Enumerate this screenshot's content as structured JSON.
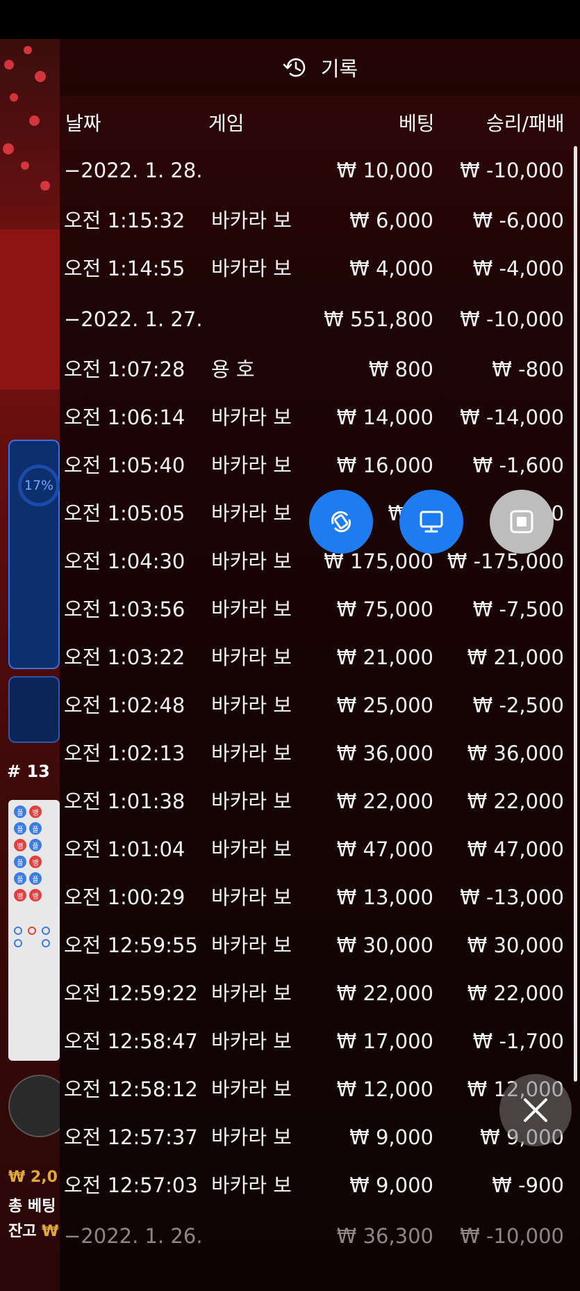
{
  "panel": {
    "title": "기록",
    "icon": "history-icon"
  },
  "columns": {
    "date": "날짜",
    "game": "게임",
    "bet": "베팅",
    "winloss": "승리/패배"
  },
  "rows": [
    {
      "type": "group",
      "date": "−2022. 1. 28.",
      "game": "",
      "bet": "₩ 10,000",
      "win": "₩ -10,000"
    },
    {
      "type": "item",
      "date": "오전 1:15:32",
      "game": "바카라 보",
      "bet": "₩ 6,000",
      "win": "₩ -6,000"
    },
    {
      "type": "item",
      "date": "오전 1:14:55",
      "game": "바카라 보",
      "bet": "₩ 4,000",
      "win": "₩ -4,000"
    },
    {
      "type": "group",
      "date": "−2022. 1. 27.",
      "game": "",
      "bet": "₩ 551,800",
      "win": "₩ -10,000"
    },
    {
      "type": "item",
      "date": "오전 1:07:28",
      "game": "용 호",
      "bet": "₩ 800",
      "win": "₩ -800"
    },
    {
      "type": "item",
      "date": "오전 1:06:14",
      "game": "바카라 보",
      "bet": "₩ 14,000",
      "win": "₩ -14,000"
    },
    {
      "type": "item",
      "date": "오전 1:05:40",
      "game": "바카라 보",
      "bet": "₩ 16,000",
      "win": "₩ -1,600"
    },
    {
      "type": "item",
      "date": "오전 1:05:05",
      "game": "바카라 보",
      "bet": "₩ 8,",
      "win": "00"
    },
    {
      "type": "item",
      "date": "오전 1:04:30",
      "game": "바카라 보",
      "bet": "₩ 175,000",
      "win": "₩ -175,000"
    },
    {
      "type": "item",
      "date": "오전 1:03:56",
      "game": "바카라 보",
      "bet": "₩ 75,000",
      "win": "₩ -7,500"
    },
    {
      "type": "item",
      "date": "오전 1:03:22",
      "game": "바카라 보",
      "bet": "₩ 21,000",
      "win": "₩ 21,000"
    },
    {
      "type": "item",
      "date": "오전 1:02:48",
      "game": "바카라 보",
      "bet": "₩ 25,000",
      "win": "₩ -2,500"
    },
    {
      "type": "item",
      "date": "오전 1:02:13",
      "game": "바카라 보",
      "bet": "₩ 36,000",
      "win": "₩ 36,000"
    },
    {
      "type": "item",
      "date": "오전 1:01:38",
      "game": "바카라 보",
      "bet": "₩ 22,000",
      "win": "₩ 22,000"
    },
    {
      "type": "item",
      "date": "오전 1:01:04",
      "game": "바카라 보",
      "bet": "₩ 47,000",
      "win": "₩ 47,000"
    },
    {
      "type": "item",
      "date": "오전 1:00:29",
      "game": "바카라 보",
      "bet": "₩ 13,000",
      "win": "₩ -13,000"
    },
    {
      "type": "item",
      "date": "오전 12:59:55",
      "game": "바카라 보",
      "bet": "₩ 30,000",
      "win": "₩ 30,000"
    },
    {
      "type": "item",
      "date": "오전 12:59:22",
      "game": "바카라 보",
      "bet": "₩ 22,000",
      "win": "₩ 22,000"
    },
    {
      "type": "item",
      "date": "오전 12:58:47",
      "game": "바카라 보",
      "bet": "₩ 17,000",
      "win": "₩ -1,700"
    },
    {
      "type": "item",
      "date": "오전 12:58:12",
      "game": "바카라 보",
      "bet": "₩ 12,000",
      "win": "₩ 12,000"
    },
    {
      "type": "item",
      "date": "오전 12:57:37",
      "game": "바카라 보",
      "bet": "₩ 9,000",
      "win": "₩ 9,000"
    },
    {
      "type": "item",
      "date": "오전 12:57:03",
      "game": "바카라 보",
      "bet": "₩ 9,000",
      "win": "₩ -900"
    },
    {
      "type": "group",
      "date": "−2022. 1. 26.",
      "game": "",
      "bet": "₩ 36,300",
      "win": "₩ -10,000",
      "dim": true
    }
  ],
  "background": {
    "progress_percent": "17%",
    "round_number": "# 13",
    "balance_amount": "₩ 2,0",
    "total_bet_label": "총 베팅",
    "balance_label": "잔고",
    "balance_currency": "₩"
  },
  "floating_buttons": {
    "rotate": "rotate-icon",
    "screen": "monitor-icon",
    "stop": "stop-icon",
    "close": "close-icon"
  },
  "colors": {
    "accent_blue": "#1f7cf0",
    "panel_bg": "#1a0505",
    "text": "#ffffff"
  }
}
